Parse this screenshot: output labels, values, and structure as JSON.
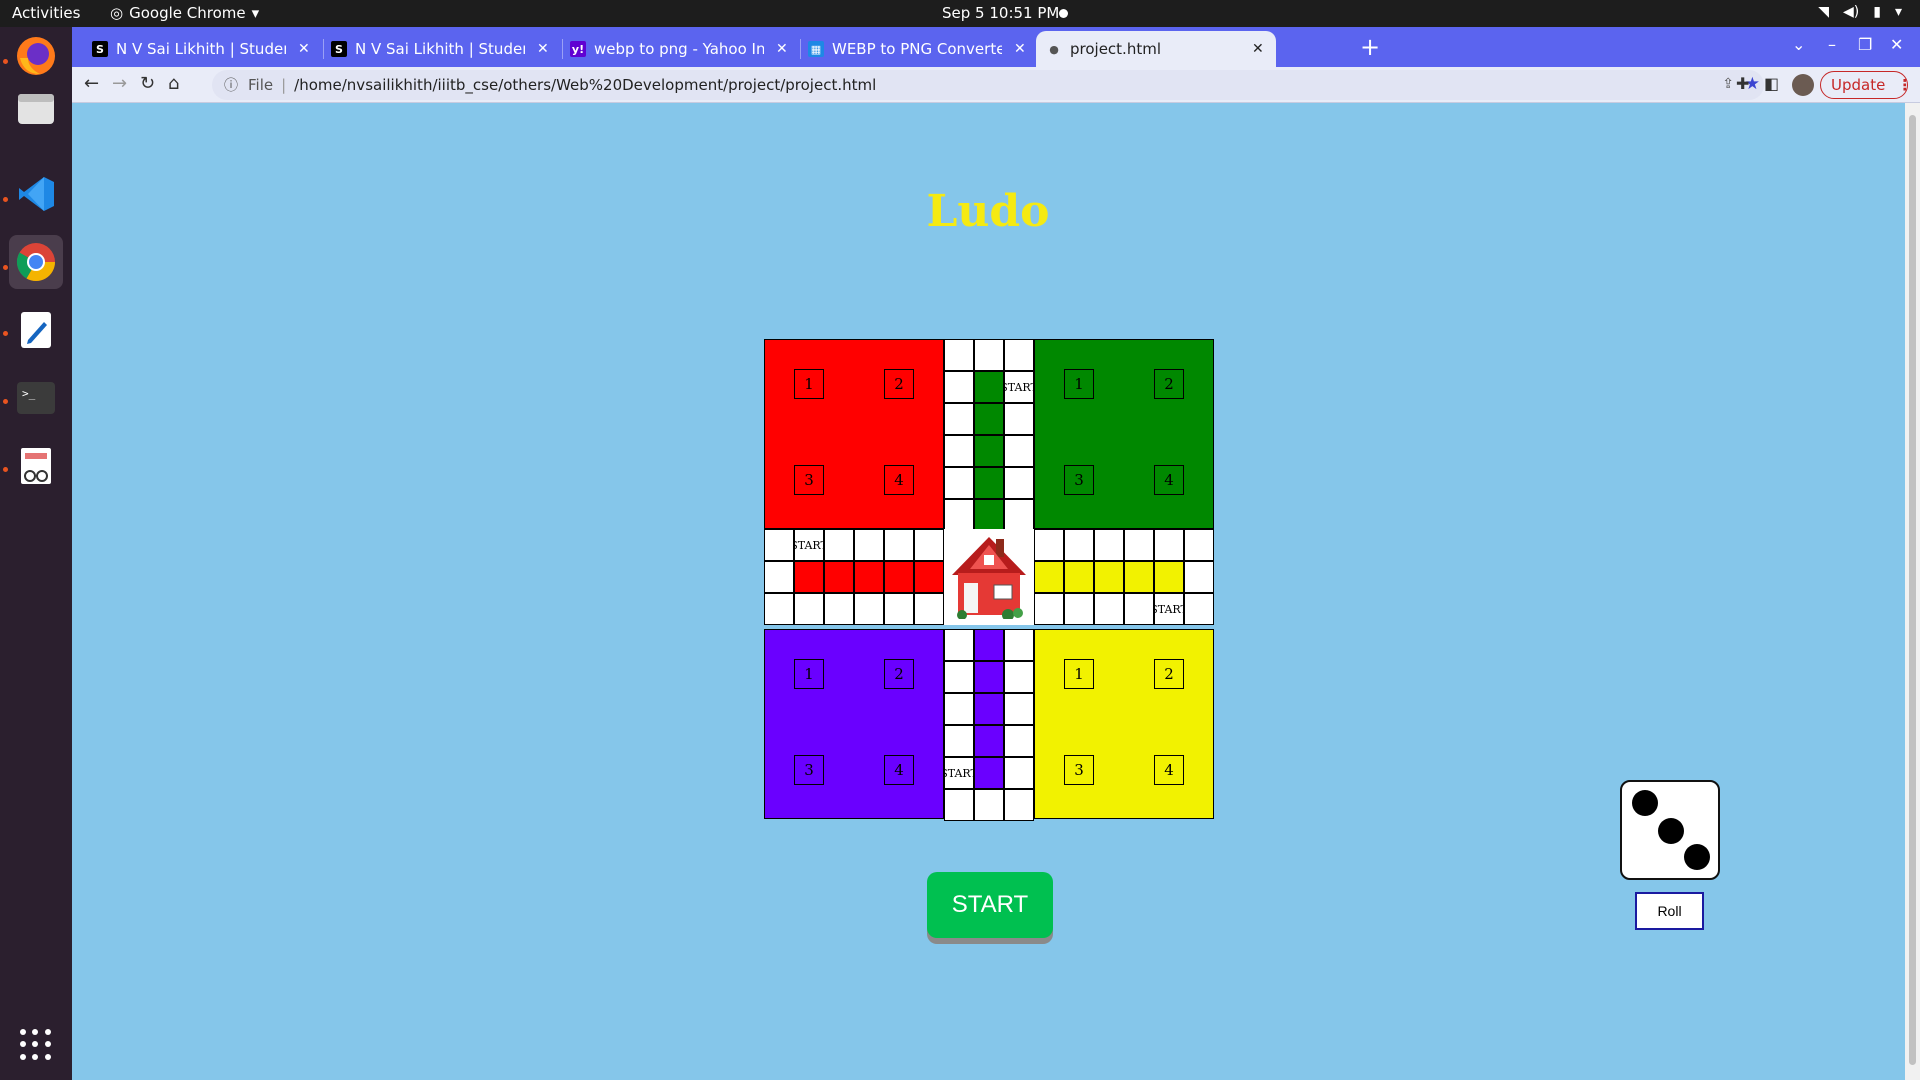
{
  "system": {
    "activities": "Activities",
    "app_menu": "Google Chrome",
    "clock": "Sep 5  10:51 PM"
  },
  "browser": {
    "tabs": [
      {
        "label": "N V Sai Likhith | Student a",
        "favicon": "S",
        "favicon_color": "#000000"
      },
      {
        "label": "N V Sai Likhith | Student a",
        "favicon": "S",
        "favicon_color": "#000000"
      },
      {
        "label": "webp to png - Yahoo India",
        "favicon": "y!",
        "favicon_color": "#6001d2"
      },
      {
        "label": "WEBP to PNG Converter -",
        "favicon": "▦",
        "favicon_color": "#1e88e5"
      },
      {
        "label": "project.html",
        "favicon": "●",
        "favicon_color": "#555555"
      }
    ],
    "address": {
      "scheme": "File",
      "url": "/home/nvsailikhith/iiitb_cse/others/Web%20Development/project/project.html"
    },
    "update_label": "Update"
  },
  "game": {
    "title": "Ludo",
    "start_label": "START",
    "roll_label": "Roll",
    "dice_value": 3,
    "start_marker": "START",
    "base_slots": [
      "1",
      "2",
      "3",
      "4"
    ],
    "colors": {
      "red": "#ff0000",
      "green": "#008800",
      "blue": "#6a00ff",
      "yellow": "#f2f200",
      "title": "#f5ea12",
      "start_button": "#00c050"
    }
  }
}
